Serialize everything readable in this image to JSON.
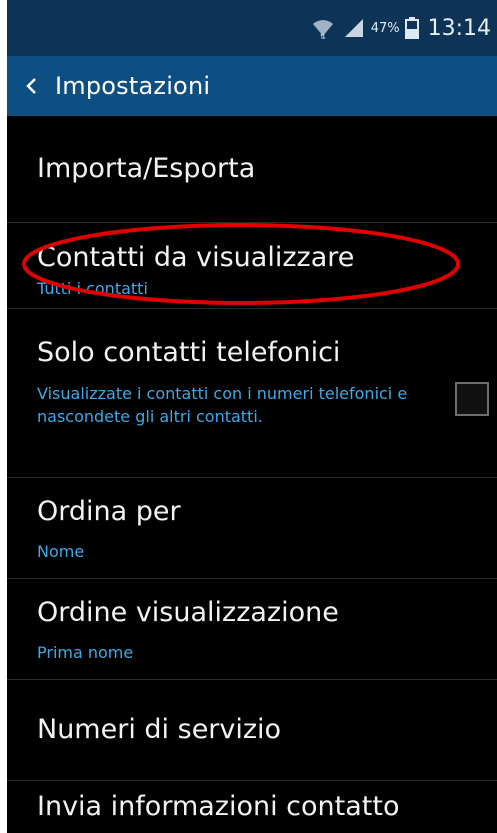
{
  "status_bar": {
    "battery_percent": "47%",
    "time": "13:14",
    "icons": [
      "wifi-icon",
      "signal-icon",
      "battery-icon"
    ]
  },
  "action_bar": {
    "back_icon": "chevron-left-icon",
    "title": "Impostazioni"
  },
  "settings": {
    "items": [
      {
        "title": "Importa/Esporta",
        "subtitle": ""
      },
      {
        "title": "Contatti da visualizzare",
        "subtitle": "Tutti i contatti"
      },
      {
        "title": "Solo contatti telefonici",
        "subtitle": "Visualizzate i contatti con i numeri telefonici e nascondete gli altri contatti.",
        "checked": false
      },
      {
        "title": "Ordina per",
        "subtitle": "Nome"
      },
      {
        "title": "Ordine visualizzazione",
        "subtitle": "Prima nome"
      },
      {
        "title": "Numeri di servizio",
        "subtitle": ""
      },
      {
        "title": "Invia informazioni contatto",
        "subtitle": ""
      }
    ]
  },
  "colors": {
    "status_bar": "#0d3456",
    "action_bar": "#0e4f83",
    "background": "#000000",
    "subtitle": "#3ea9e6",
    "annotation": "#e00000"
  }
}
